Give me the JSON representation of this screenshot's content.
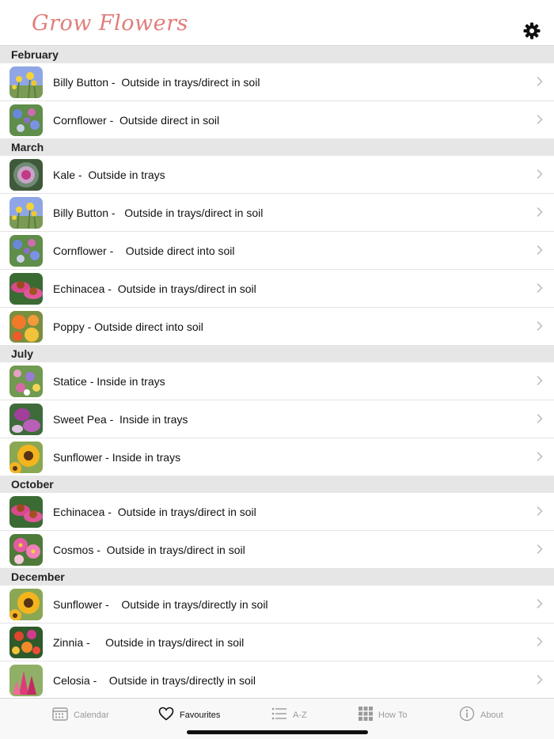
{
  "app": {
    "title": "Grow Flowers"
  },
  "header": {
    "settings_icon": "gear-icon"
  },
  "colors": {
    "title": "#e07d7b",
    "section_bg": "#e6e6e6",
    "active_tab": "#111111",
    "inactive_tab": "#9a9a9a"
  },
  "sections": [
    {
      "month": "February",
      "items": [
        {
          "label": "Billy Button -  Outside in trays/direct in soil",
          "thumb": "billy-button"
        },
        {
          "label": "Cornflower -  Outside direct in soil",
          "thumb": "cornflower"
        }
      ]
    },
    {
      "month": "March",
      "items": [
        {
          "label": "Kale -  Outside in trays",
          "thumb": "kale"
        },
        {
          "label": "Billy Button -   Outside in trays/direct in soil",
          "thumb": "billy-button"
        },
        {
          "label": "Cornflower -    Outside direct into soil",
          "thumb": "cornflower"
        },
        {
          "label": "Echinacea -  Outside in trays/direct in soil",
          "thumb": "echinacea"
        },
        {
          "label": "Poppy - Outside direct into soil",
          "thumb": "poppy"
        }
      ]
    },
    {
      "month": "July",
      "items": [
        {
          "label": "Statice - Inside in trays",
          "thumb": "statice"
        },
        {
          "label": "Sweet Pea -  Inside in trays",
          "thumb": "sweet-pea"
        },
        {
          "label": "Sunflower - Inside in trays",
          "thumb": "sunflower"
        }
      ]
    },
    {
      "month": "October",
      "items": [
        {
          "label": "Echinacea -  Outside in trays/direct in soil",
          "thumb": "echinacea"
        },
        {
          "label": "Cosmos -  Outside in trays/direct in soil",
          "thumb": "cosmos"
        }
      ]
    },
    {
      "month": "December",
      "items": [
        {
          "label": "Sunflower -    Outside in trays/directly in soil",
          "thumb": "sunflower"
        },
        {
          "label": "Zinnia -     Outside in trays/direct in soil",
          "thumb": "zinnia"
        },
        {
          "label": "Celosia -    Outside in trays/directly in soil",
          "thumb": "celosia"
        }
      ]
    }
  ],
  "tabs": [
    {
      "label": "Calendar",
      "icon": "calendar-icon",
      "active": false
    },
    {
      "label": "Favourites",
      "icon": "heart-icon",
      "active": true
    },
    {
      "label": "A-Z",
      "icon": "list-icon",
      "active": false
    },
    {
      "label": "How To",
      "icon": "grid-icon",
      "active": false
    },
    {
      "label": "About",
      "icon": "info-icon",
      "active": false
    }
  ]
}
